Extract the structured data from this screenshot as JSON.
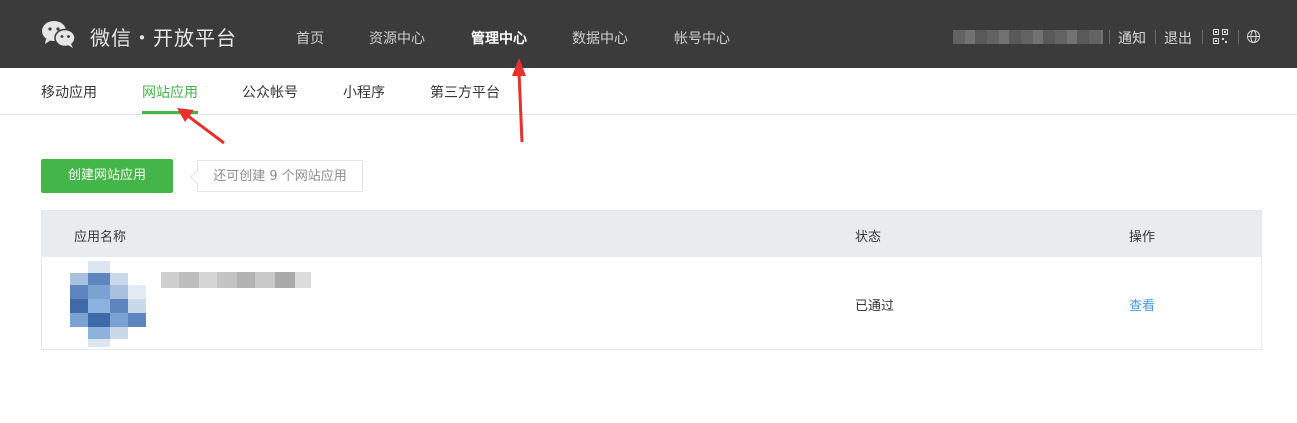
{
  "topbar": {
    "brand": "微信・开放平台",
    "nav": [
      "首页",
      "资源中心",
      "管理中心",
      "数据中心",
      "帐号中心"
    ],
    "active_nav": "管理中心",
    "right": {
      "notify": "通知",
      "logout": "退出"
    }
  },
  "subnav": {
    "tabs": [
      "移动应用",
      "网站应用",
      "公众帐号",
      "小程序",
      "第三方平台"
    ],
    "active": "网站应用"
  },
  "actions": {
    "create_label": "创建网站应用",
    "hint": "还可创建 9 个网站应用"
  },
  "table": {
    "headers": {
      "name": "应用名称",
      "status": "状态",
      "action": "操作"
    },
    "rows": [
      {
        "status": "已通过",
        "action": "查看"
      }
    ]
  },
  "colors": {
    "topbar_bg": "#3b3b3b",
    "accent_green": "#44b549",
    "link_blue": "#459ae9",
    "annotation_red": "#e8302c"
  }
}
